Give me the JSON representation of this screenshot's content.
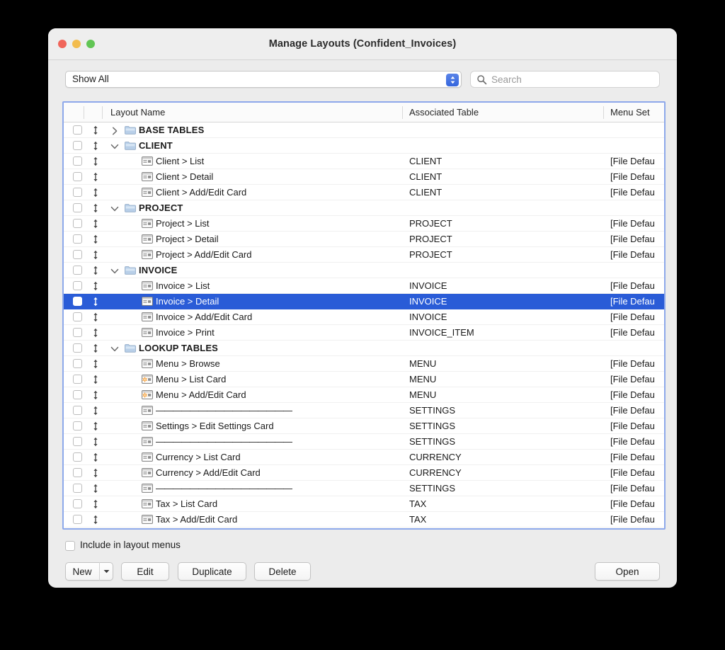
{
  "window": {
    "title": "Manage Layouts (Confident_Invoices)",
    "traffic_lights": [
      "close",
      "minimize",
      "maximize"
    ]
  },
  "toolbar": {
    "filter_value": "Show All",
    "filter_icon": "updown-chevrons-icon",
    "search_placeholder": "Search",
    "search_value": "",
    "search_icon": "search-icon"
  },
  "list": {
    "columns": [
      "Layout Name",
      "Associated Table",
      "Menu Set"
    ],
    "rows": [
      {
        "kind": "group",
        "name": "BASE TABLES",
        "table": "",
        "menu": "",
        "expanded": false,
        "icon": "folder-icon",
        "selected": false
      },
      {
        "kind": "group",
        "name": "CLIENT",
        "table": "",
        "menu": "",
        "expanded": true,
        "icon": "folder-icon",
        "selected": false
      },
      {
        "kind": "layout",
        "name": "Client > List",
        "table": "CLIENT",
        "menu": "[File Defau",
        "icon": "layout-icon",
        "selected": false
      },
      {
        "kind": "layout",
        "name": "Client > Detail",
        "table": "CLIENT",
        "menu": "[File Defau",
        "icon": "layout-icon",
        "selected": false
      },
      {
        "kind": "layout",
        "name": "Client > Add/Edit Card",
        "table": "CLIENT",
        "menu": "[File Defau",
        "icon": "layout-icon",
        "selected": false
      },
      {
        "kind": "group",
        "name": "PROJECT",
        "table": "",
        "menu": "",
        "expanded": true,
        "icon": "folder-icon",
        "selected": false
      },
      {
        "kind": "layout",
        "name": "Project > List",
        "table": "PROJECT",
        "menu": "[File Defau",
        "icon": "layout-icon",
        "selected": false
      },
      {
        "kind": "layout",
        "name": "Project > Detail",
        "table": "PROJECT",
        "menu": "[File Defau",
        "icon": "layout-icon",
        "selected": false
      },
      {
        "kind": "layout",
        "name": "Project > Add/Edit Card",
        "table": "PROJECT",
        "menu": "[File Defau",
        "icon": "layout-icon",
        "selected": false
      },
      {
        "kind": "group",
        "name": "INVOICE",
        "table": "",
        "menu": "",
        "expanded": true,
        "icon": "folder-icon",
        "selected": false
      },
      {
        "kind": "layout",
        "name": "Invoice > List",
        "table": "INVOICE",
        "menu": "[File Defau",
        "icon": "layout-icon",
        "selected": false
      },
      {
        "kind": "layout",
        "name": "Invoice > Detail",
        "table": "INVOICE",
        "menu": "[File Defau",
        "icon": "layout-icon",
        "selected": true
      },
      {
        "kind": "layout",
        "name": "Invoice > Add/Edit Card",
        "table": "INVOICE",
        "menu": "[File Defau",
        "icon": "layout-icon",
        "selected": false
      },
      {
        "kind": "layout",
        "name": "Invoice > Print",
        "table": "INVOICE_ITEM",
        "menu": "[File Defau",
        "icon": "layout-icon",
        "selected": false
      },
      {
        "kind": "group",
        "name": "LOOKUP TABLES",
        "table": "",
        "menu": "",
        "expanded": true,
        "icon": "folder-icon",
        "selected": false
      },
      {
        "kind": "layout",
        "name": "Menu > Browse",
        "table": "MENU",
        "menu": "[File Defau",
        "icon": "layout-icon",
        "selected": false
      },
      {
        "kind": "layout",
        "name": "Menu > List Card",
        "table": "MENU",
        "menu": "[File Defau",
        "icon": "layout-card-icon",
        "selected": false
      },
      {
        "kind": "layout",
        "name": "Menu > Add/Edit Card",
        "table": "MENU",
        "menu": "[File Defau",
        "icon": "layout-card-icon",
        "selected": false
      },
      {
        "kind": "separator",
        "name": "————————————————",
        "table": "SETTINGS",
        "menu": "[File Defau",
        "icon": "layout-icon",
        "selected": false
      },
      {
        "kind": "layout",
        "name": "Settings > Edit Settings Card",
        "table": "SETTINGS",
        "menu": "[File Defau",
        "icon": "layout-icon",
        "selected": false
      },
      {
        "kind": "separator",
        "name": "————————————————",
        "table": "SETTINGS",
        "menu": "[File Defau",
        "icon": "layout-icon",
        "selected": false
      },
      {
        "kind": "layout",
        "name": "Currency > List Card",
        "table": "CURRENCY",
        "menu": "[File Defau",
        "icon": "layout-icon",
        "selected": false
      },
      {
        "kind": "layout",
        "name": "Currency > Add/Edit Card",
        "table": "CURRENCY",
        "menu": "[File Defau",
        "icon": "layout-icon",
        "selected": false
      },
      {
        "kind": "separator",
        "name": "————————————————",
        "table": "SETTINGS",
        "menu": "[File Defau",
        "icon": "layout-icon",
        "selected": false
      },
      {
        "kind": "layout",
        "name": "Tax > List Card",
        "table": "TAX",
        "menu": "[File Defau",
        "icon": "layout-icon",
        "selected": false
      },
      {
        "kind": "layout",
        "name": "Tax > Add/Edit Card",
        "table": "TAX",
        "menu": "[File Defau",
        "icon": "layout-icon",
        "selected": false
      }
    ]
  },
  "footer": {
    "include_label": "Include in layout menus",
    "include_checked": false,
    "buttons": {
      "new": "New",
      "new_menu_icon": "triangle-down-icon",
      "edit": "Edit",
      "duplicate": "Duplicate",
      "delete": "Delete",
      "open": "Open"
    }
  },
  "colors": {
    "selection_blue": "#2a5cd7",
    "focus_ring": "#8da8ea",
    "popup_accent": "#3f6fe0",
    "traffic_close": "#f0655a",
    "traffic_min": "#f2bc4e",
    "traffic_max": "#61c554"
  }
}
